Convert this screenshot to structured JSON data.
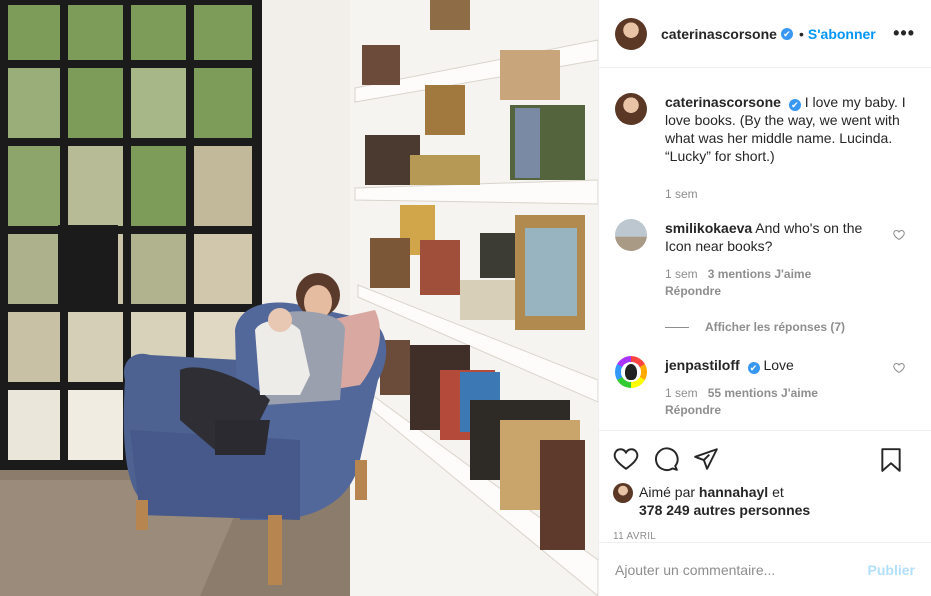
{
  "post": {
    "username": "caterinascorsone",
    "verified_mark": "✔",
    "separator": "•",
    "follow_label": "S'abonner",
    "more_label": "•••",
    "caption": {
      "username": "caterinascorsone",
      "text": "I love my baby. I love books. (By the way, we went with what was her middle name. Lucinda. “Lucky” for short.)",
      "time": "1 sem"
    },
    "comments": [
      {
        "username": "smilikokaeva",
        "text": "And who's on the Icon near books?",
        "time": "1 sem",
        "likes": "3 mentions J'aime",
        "reply": "Répondre"
      },
      {
        "username": "jenpastiloff",
        "verified": true,
        "text": "Love",
        "time": "1 sem",
        "likes": "55 mentions J'aime",
        "reply": "Répondre"
      }
    ],
    "view_replies": "Afficher les réponses (7)",
    "liked_by_prefix": "Aimé par",
    "liked_by_user": "hannahayl",
    "liked_by_and": "et",
    "liked_by_others": "378 249 autres personnes",
    "date": "11 AVRIL",
    "add_comment_placeholder": "Ajouter un commentaire...",
    "publish_label": "Publier"
  },
  "icons": {
    "like": "heart-icon",
    "comment": "comment-icon",
    "share": "share-icon",
    "save": "bookmark-icon",
    "small_like": "heart-small-icon"
  },
  "colors": {
    "accent": "#0095f6",
    "verified": "#3897f0",
    "muted": "#8e8e8e",
    "publish_disabled": "#b2dffc"
  }
}
